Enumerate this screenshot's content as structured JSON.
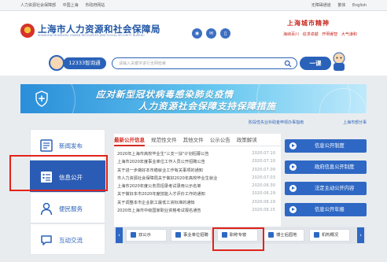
{
  "topbar": {
    "left_links": [
      "人力资源社会保障部",
      "中国上海",
      "市政府网站"
    ],
    "right_links": [
      "无障碍通道",
      "繁体",
      "English"
    ]
  },
  "header": {
    "site_title": "上海市人力资源和社会保障局",
    "site_subtitle": "SHANGHAI MUNICIPAL HUMAN RESOURCES AND SOCIAL SECURITY BUREAU",
    "slogan_title": "上海城市精神",
    "slogan_tags": [
      "海纳百川",
      "追求卓越",
      "开明睿智",
      "大气谦和"
    ]
  },
  "search": {
    "hotline_label": "12333智询通",
    "placeholder": "请输入关键字进行全网检索",
    "yike_label": "一课"
  },
  "banner": {
    "line1": "应对新型冠状病毒感染肺炎疫情",
    "line2": "人力资源社会保障支持保障措施"
  },
  "ticker": {
    "item1": "阶段性失业补助金申领办事指南",
    "item2": "上海市部分事"
  },
  "sidebar": {
    "items": [
      {
        "label": "新闻发布"
      },
      {
        "label": "信息公开"
      },
      {
        "label": "便民服务"
      },
      {
        "label": "互动交流"
      }
    ]
  },
  "main": {
    "tabs": [
      "最新公开信息",
      "规范性文件",
      "其他文件",
      "公示公告",
      "政策解读"
    ],
    "news": [
      {
        "title": "2020年上海市高校毕业生\"三支一扶\"计划招募公告",
        "date": "2020.07.10"
      },
      {
        "title": "上海市2020年度事业单位工作人员公开招聘公告",
        "date": "2020.07.10"
      },
      {
        "title": "关于进一步做好本市稳就业工作有关事项的通知",
        "date": "2020.07.09"
      },
      {
        "title": "市人力资源社会保障局关于做好2020年高校毕业生就业",
        "date": "2020.07.03"
      },
      {
        "title": "上海市2020年度公务员招录考试录用公示名单",
        "date": "2020.06.30"
      },
      {
        "title": "关于做好本市2020年度技能人才评价工作的通知",
        "date": "2020.06.29"
      },
      {
        "title": "关于调整本市企业职工最低工资标准的通知",
        "date": "2020.06.19"
      },
      {
        "title": "2020年上海市中级国家职业资格考试报名通告",
        "date": "2020.06.15"
      }
    ]
  },
  "rightcol": {
    "buttons": [
      "信息公开制度",
      "政府信息公开制度",
      "法定主动公开内容",
      "信息公开年报"
    ]
  },
  "strip": {
    "items": [
      "双公示",
      "事业单位招聘",
      "职称专窗",
      "博士后园地",
      "机构概况"
    ]
  },
  "colors": {
    "brand_blue": "#2a62b9",
    "accent_red": "#d42b21",
    "highlight_box": "#e2231a"
  }
}
